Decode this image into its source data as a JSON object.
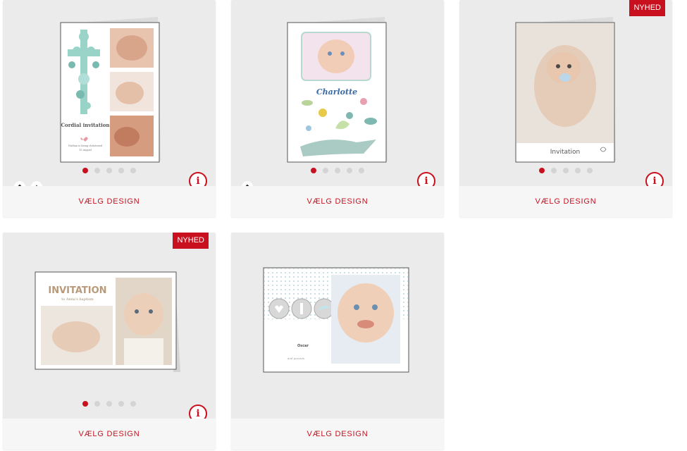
{
  "cards": [
    {
      "cta": "VÆLG DESIGN",
      "dots": 5,
      "active_dot": 0,
      "icons": [
        "diamond-icon",
        "paint-bucket-icon"
      ],
      "thumb": {
        "title": "Cordial invitation",
        "sub1": "Nathan is being christened",
        "sub2": "15 August"
      }
    },
    {
      "cta": "VÆLG DESIGN",
      "dots": 5,
      "active_dot": 0,
      "icons": [
        "diamond-icon"
      ],
      "thumb": {
        "name": "Charlotte"
      }
    },
    {
      "badge": "NYHED",
      "cta": "VÆLG DESIGN",
      "dots": 5,
      "active_dot": 0,
      "thumb": {
        "title": "Invitation"
      }
    },
    {
      "badge": "NYHED",
      "cta": "VÆLG DESIGN",
      "dots": 5,
      "active_dot": 0,
      "thumb": {
        "title": "INVITATION",
        "sub": "to Anna's baptism"
      }
    },
    {
      "cta": "VÆLG DESIGN",
      "thumb": {
        "name": "Oscar",
        "sub": "and parents"
      }
    }
  ],
  "info_glyph": "i",
  "colors": {
    "accent": "#c8101e",
    "card_bg": "#ebebeb",
    "footer_bg": "#f6f6f6"
  }
}
